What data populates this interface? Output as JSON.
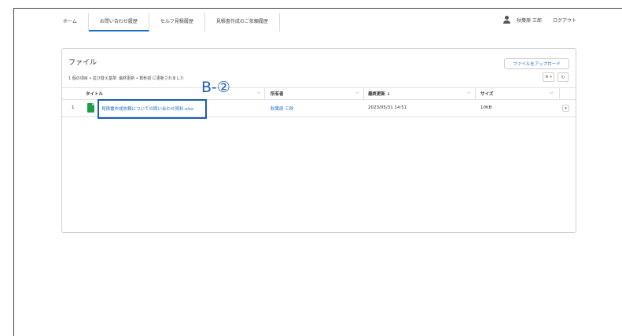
{
  "nav": {
    "tabs": [
      "ホーム",
      "お問い合わせ履歴",
      "セルフ見積履歴",
      "見積書作成のご依頼履歴"
    ],
    "active_index": 1,
    "user_name": "秋葉原 三郎",
    "logout": "ログアウト"
  },
  "panel": {
    "title": "ファイル",
    "meta": "1 個の項目 • 並び替え基準: 最終更新 • 数秒前 に更新されました",
    "upload_label": "ファイルをアップロード",
    "gear_label": "⚙ ▾",
    "refresh_label": "↻"
  },
  "table": {
    "headers": {
      "title": "タイトル",
      "owner": "所有者",
      "modified": "最終更新 ↓",
      "size": "サイズ"
    },
    "rows": [
      {
        "index": "1",
        "title": "見積書作成依頼についての問い合わせ資料.xlsx",
        "owner": "秋葉原 三郎",
        "modified": "2023/05/31 14:51",
        "size": "10KB"
      }
    ]
  },
  "annotation": {
    "label": "B-②"
  },
  "colors": {
    "accent": "#1b6fc8",
    "annotation": "#1b5fb5",
    "xlsx": "#1e9b47"
  }
}
